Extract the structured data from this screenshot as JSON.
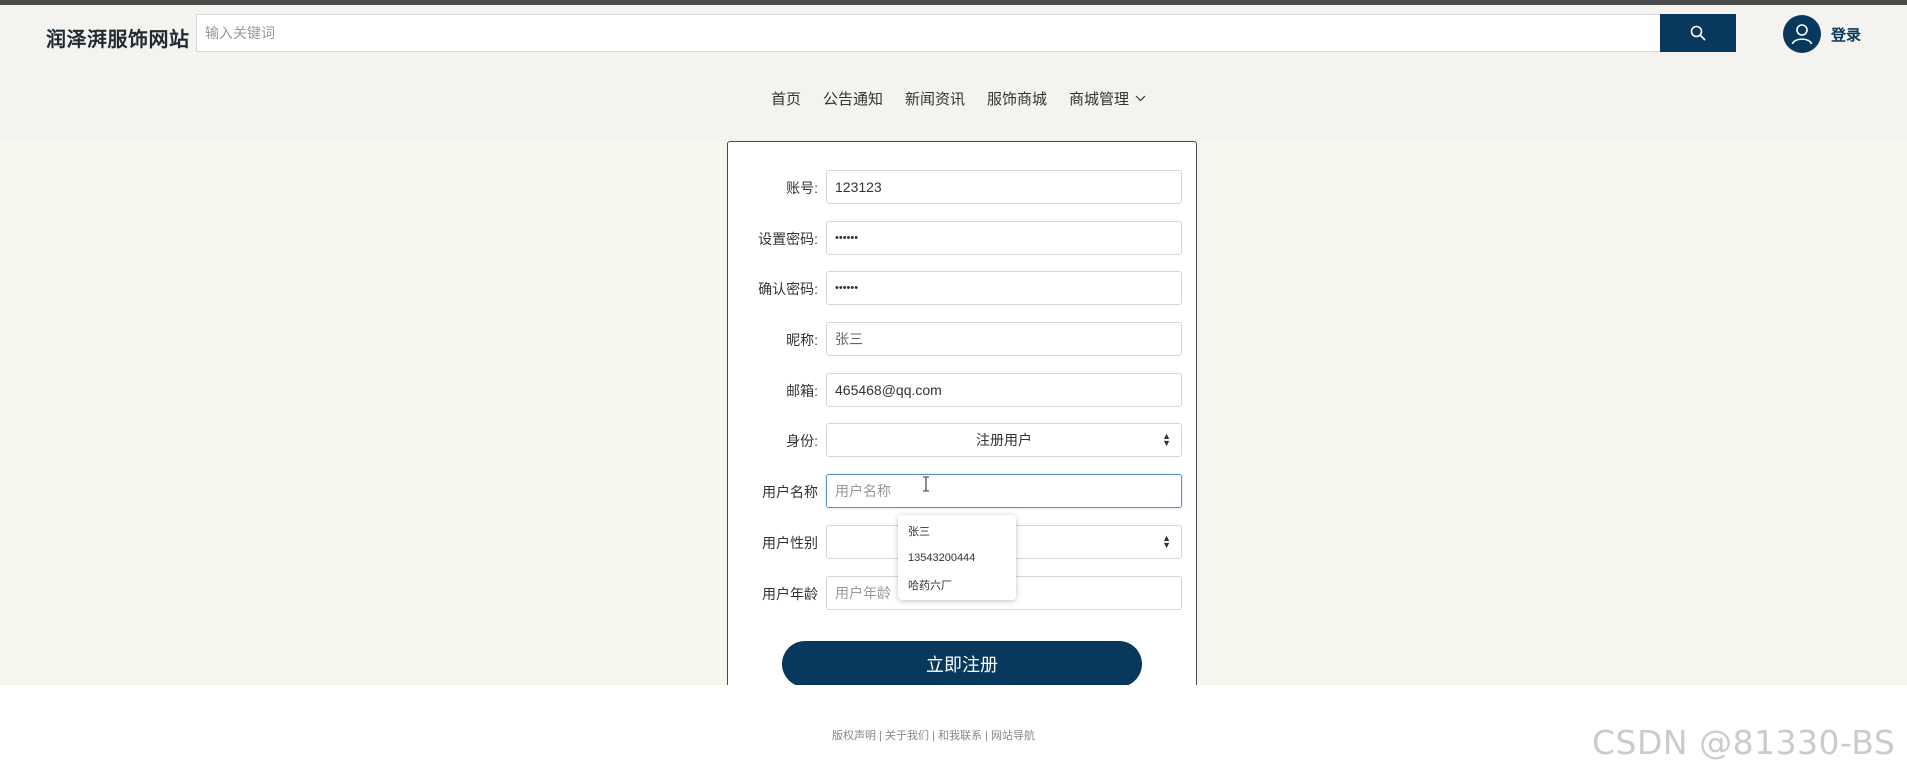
{
  "header": {
    "site_title": "润泽湃服饰网站",
    "search_placeholder": "输入关键词",
    "login_label": "登录"
  },
  "nav": {
    "items": [
      {
        "label": "首页"
      },
      {
        "label": "公告通知"
      },
      {
        "label": "新闻资讯"
      },
      {
        "label": "服饰商城"
      },
      {
        "label": "商城管理",
        "has_dropdown": true
      }
    ]
  },
  "form": {
    "account": {
      "label": "账号:",
      "value": "123123"
    },
    "password": {
      "label": "设置密码:",
      "value": "••••••"
    },
    "confirm_password": {
      "label": "确认密码:",
      "value": "••••••"
    },
    "nickname": {
      "label": "昵称:",
      "value": "张三"
    },
    "email": {
      "label": "邮箱:",
      "value": "465468@qq.com"
    },
    "identity": {
      "label": "身份:",
      "value": "注册用户"
    },
    "username": {
      "label": "用户名称",
      "placeholder": "用户名称"
    },
    "gender": {
      "label": "用户性别",
      "value": ""
    },
    "age": {
      "label": "用户年龄",
      "placeholder": "用户年龄"
    },
    "submit_label": "立即注册"
  },
  "autocomplete": {
    "items": [
      "张三",
      "13543200444",
      "哈药六厂"
    ]
  },
  "footer": {
    "link1": "版权声明",
    "link2": "关于我们",
    "link3": "和我联系",
    "link4": "网站导航",
    "separator": "|"
  },
  "watermark": "CSDN @81330-BS",
  "colors": {
    "primary": "#08385c",
    "header_bg": "#f4f3ef",
    "main_bg": "#f7f6ee"
  }
}
